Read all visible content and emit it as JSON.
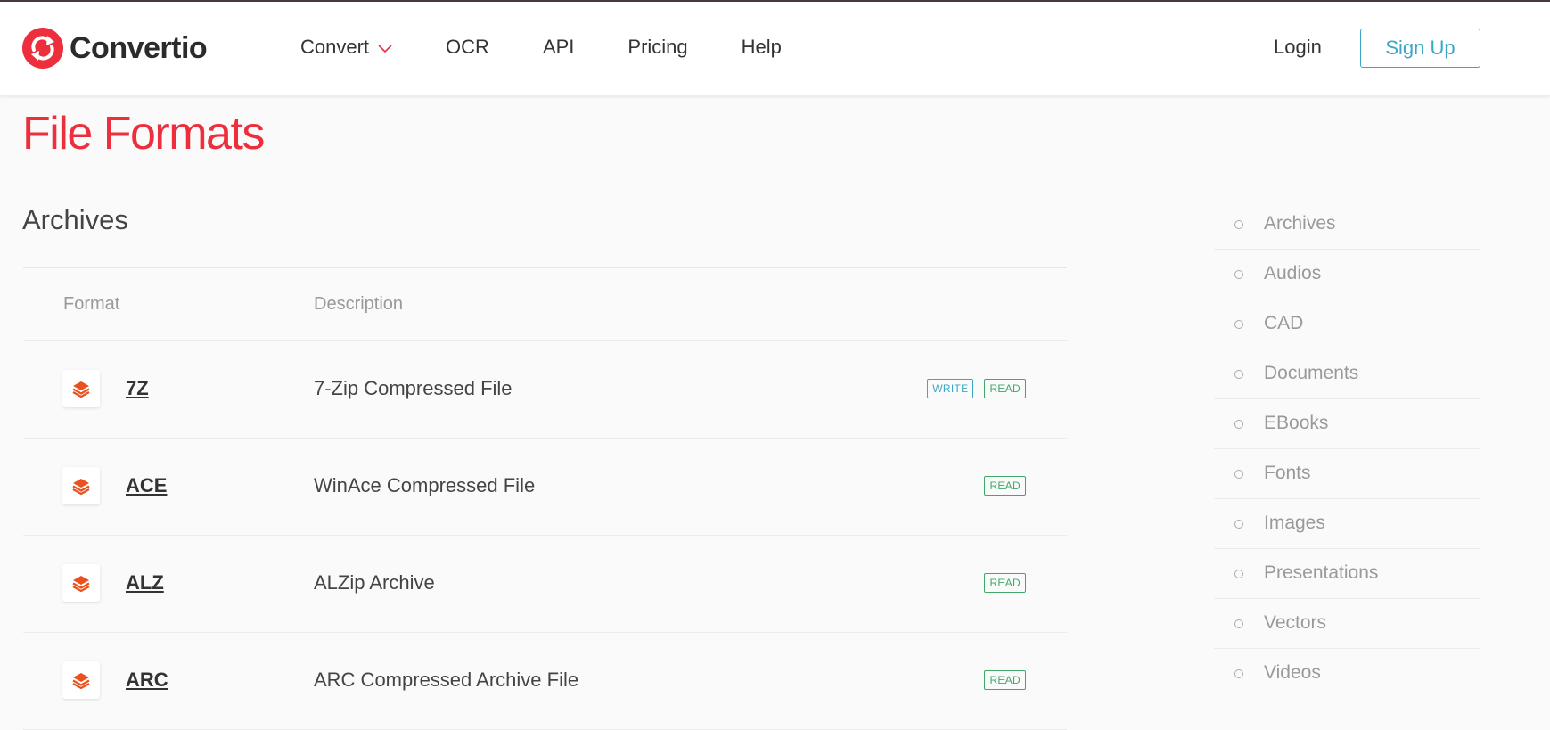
{
  "header": {
    "logo_text": "Convertio",
    "nav": [
      {
        "label": "Convert",
        "has_dropdown": true
      },
      {
        "label": "OCR"
      },
      {
        "label": "API"
      },
      {
        "label": "Pricing"
      },
      {
        "label": "Help"
      }
    ],
    "login_label": "Login",
    "signup_label": "Sign Up"
  },
  "page": {
    "title": "File Formats",
    "section_title": "Archives"
  },
  "table": {
    "headers": {
      "format": "Format",
      "description": "Description"
    },
    "rows": [
      {
        "name": "7Z",
        "description": "7-Zip Compressed File",
        "badges": [
          "WRITE",
          "READ"
        ]
      },
      {
        "name": "ACE",
        "description": "WinAce Compressed File",
        "badges": [
          "READ"
        ]
      },
      {
        "name": "ALZ",
        "description": "ALZip Archive",
        "badges": [
          "READ"
        ]
      },
      {
        "name": "ARC",
        "description": "ARC Compressed Archive File",
        "badges": [
          "READ"
        ]
      }
    ]
  },
  "sidebar": {
    "items": [
      {
        "label": "Archives"
      },
      {
        "label": "Audios"
      },
      {
        "label": "CAD"
      },
      {
        "label": "Documents"
      },
      {
        "label": "EBooks"
      },
      {
        "label": "Fonts"
      },
      {
        "label": "Images"
      },
      {
        "label": "Presentations"
      },
      {
        "label": "Vectors"
      },
      {
        "label": "Videos"
      }
    ]
  },
  "colors": {
    "brand_red": "#ed2f3d",
    "accent_blue": "#3aa8c4",
    "read_green": "#3fa86b",
    "format_icon_orange": "#e8521f"
  },
  "icons": {
    "logo": "convert-arrows-icon",
    "dropdown": "chevron-down-icon",
    "format": "layers-icon",
    "sidebar_bullet": "circle-bullet-icon"
  }
}
